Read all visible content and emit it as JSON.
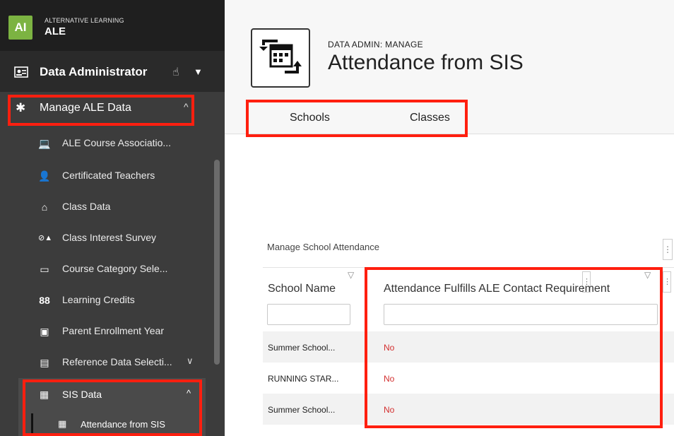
{
  "brand": {
    "logo": "AI",
    "small": "ALTERNATIVE LEARNING",
    "name": "ALE"
  },
  "role": {
    "label": "Data Administrator"
  },
  "section": {
    "label": "Manage ALE Data"
  },
  "sidebar": {
    "items": [
      {
        "label": "ALE Course Associatio...",
        "icon": "laptop-user-icon"
      },
      {
        "label": "Certificated Teachers",
        "icon": "teacher-icon"
      },
      {
        "label": "Class Data",
        "icon": "school-icon"
      },
      {
        "label": "Class Interest Survey",
        "icon": "survey-icon"
      },
      {
        "label": "Course Category Sele...",
        "icon": "monitor-icon"
      },
      {
        "label": "Learning Credits",
        "icon": "credits-icon"
      },
      {
        "label": "Parent Enrollment Year",
        "icon": "form-icon"
      },
      {
        "label": "Reference Data Selecti...",
        "icon": "clipboard-icon"
      }
    ],
    "sub_item": {
      "label": "SIS Data"
    },
    "sub_sub_item": {
      "label": "Attendance from SIS"
    }
  },
  "header": {
    "pre": "DATA ADMIN: MANAGE",
    "title": "Attendance from SIS"
  },
  "tabs": [
    {
      "label": "Schools"
    },
    {
      "label": "Classes"
    }
  ],
  "grid": {
    "title": "Manage School Attendance",
    "columns": [
      {
        "label": "School Name"
      },
      {
        "label": "Attendance Fulfills ALE Contact Requirement"
      }
    ],
    "rows": [
      {
        "school": "Summer School...",
        "fulfills": "No"
      },
      {
        "school": "RUNNING STAR...",
        "fulfills": "No"
      },
      {
        "school": "Summer School...",
        "fulfills": "No"
      }
    ]
  },
  "colors": {
    "highlight": "#ff1f0f",
    "no_value": "#d32f2f",
    "logo": "#7cb342",
    "sidebar": "#3c3c3c"
  }
}
